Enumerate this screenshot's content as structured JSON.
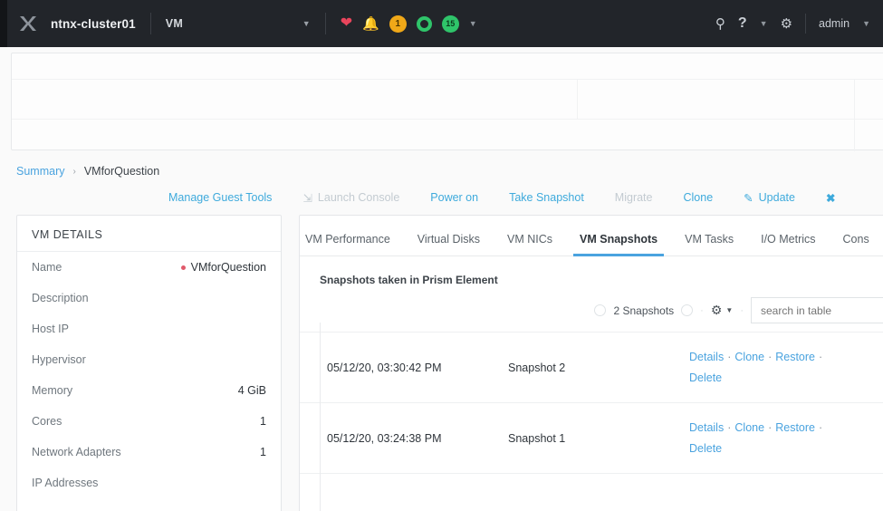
{
  "topbar": {
    "logo_icon": "nutanix-x-icon",
    "cluster_name": "ntnx-cluster01",
    "entity_selector": {
      "label": "VM",
      "caret_icon": "chevron-down-icon"
    },
    "status": {
      "health_icon": "heart-icon",
      "alert_icon": "bell-icon",
      "warning_count": "1",
      "ok_ring_icon": "circle-ring-icon",
      "task_count": "15",
      "caret_icon": "chevron-down-icon"
    },
    "search_icon": "search-icon",
    "help_icon": "question-mark-icon",
    "help_caret_icon": "chevron-down-icon",
    "settings_icon": "gear-icon",
    "user": "admin",
    "user_caret_icon": "chevron-down-icon"
  },
  "breadcrumb": {
    "parent": "Summary",
    "separator": "›",
    "current": "VMforQuestion"
  },
  "actions": [
    {
      "label": "Manage Guest Tools",
      "disabled": false,
      "icon": ""
    },
    {
      "label": "Launch Console",
      "disabled": true,
      "icon": "console-icon"
    },
    {
      "label": "Power on",
      "disabled": false,
      "icon": ""
    },
    {
      "label": "Take Snapshot",
      "disabled": false,
      "icon": ""
    },
    {
      "label": "Migrate",
      "disabled": true,
      "icon": ""
    },
    {
      "label": "Clone",
      "disabled": false,
      "icon": ""
    },
    {
      "label": "Update",
      "disabled": false,
      "icon": "pencil-icon"
    },
    {
      "label": "",
      "disabled": false,
      "icon": "close-x-icon"
    }
  ],
  "vm_details": {
    "title": "VM DETAILS",
    "rows": [
      {
        "key": "Name",
        "value": "VMforQuestion",
        "status_dot": true
      },
      {
        "key": "Description",
        "value": "",
        "status_dot": false
      },
      {
        "key": "Host IP",
        "value": "",
        "status_dot": false
      },
      {
        "key": "Hypervisor",
        "value": "",
        "status_dot": false
      },
      {
        "key": "Memory",
        "value": "4 GiB",
        "status_dot": false
      },
      {
        "key": "Cores",
        "value": "1",
        "status_dot": false
      },
      {
        "key": "Network Adapters",
        "value": "1",
        "status_dot": false
      },
      {
        "key": "IP Addresses",
        "value": "",
        "status_dot": false
      }
    ]
  },
  "content": {
    "tabs": [
      {
        "label": "VM Performance",
        "active": false
      },
      {
        "label": "Virtual Disks",
        "active": false
      },
      {
        "label": "VM NICs",
        "active": false
      },
      {
        "label": "VM Snapshots",
        "active": true
      },
      {
        "label": "VM Tasks",
        "active": false
      },
      {
        "label": "I/O Metrics",
        "active": false
      },
      {
        "label": "Cons",
        "active": false
      }
    ],
    "caption": "Snapshots taken in Prism Element",
    "toolbar": {
      "count_label": "2 Snapshots",
      "gear_icon": "gear-icon",
      "gear_caret_icon": "chevron-down-icon",
      "search_placeholder": "search in table"
    },
    "snapshots": [
      {
        "timestamp": "05/12/20, 03:30:42 PM",
        "name": "Snapshot 2",
        "actions": [
          "Details",
          "Clone",
          "Restore",
          "Delete"
        ]
      },
      {
        "timestamp": "05/12/20, 03:24:38 PM",
        "name": "Snapshot 1",
        "actions": [
          "Details",
          "Clone",
          "Restore",
          "Delete"
        ]
      }
    ]
  },
  "colors": {
    "header_bg": "#22252a",
    "accent_link": "#4aa3df",
    "status_red": "#e8455c",
    "status_amber": "#f0a818",
    "status_green": "#2fc46a",
    "page_bg": "#fafafa"
  }
}
